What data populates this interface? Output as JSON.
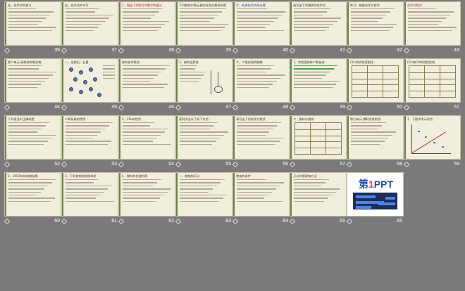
{
  "view": "slide-sorter",
  "slides": [
    {
      "number": "36",
      "title": "五、化学式的意义",
      "style": "text"
    },
    {
      "number": "37",
      "title": "五、化学式的书写",
      "style": "text"
    },
    {
      "number": "38",
      "title": "1、指出下列符号中数字的意义",
      "style": "text-red"
    },
    {
      "number": "39",
      "title": "下列物质中氮元素的化合价最高的是",
      "style": "text"
    },
    {
      "number": "40",
      "title": "六、有关化学式的计算",
      "style": "text-blue"
    },
    {
      "number": "41",
      "title": "请写出下列物质的化学式",
      "style": "text"
    },
    {
      "number": "42",
      "title": "练习：根据化学方程式",
      "style": "text"
    },
    {
      "number": "43",
      "title": "化学方程式",
      "style": "text-red"
    },
    {
      "number": "44",
      "title": "第二单元 碳和碳的氧化物",
      "style": "text"
    },
    {
      "number": "45",
      "title": "一、金刚石、石墨",
      "style": "molecule"
    },
    {
      "number": "46",
      "title": "碳的化学性质",
      "style": "text"
    },
    {
      "number": "47",
      "title": "2、碳的还原性",
      "style": "apparatus"
    },
    {
      "number": "48",
      "title": "二、二氧化碳的制取",
      "style": "text"
    },
    {
      "number": "49",
      "title": "1、实验室制取二氧化碳",
      "style": "highlight"
    },
    {
      "number": "50",
      "title": "CO₂的实验室制法",
      "style": "table"
    },
    {
      "number": "51",
      "title": "CO₂和CO的性质比较",
      "style": "table"
    },
    {
      "number": "52",
      "title": "下列说法中正确的是",
      "style": "text"
    },
    {
      "number": "53",
      "title": "二氧化碳的性质",
      "style": "text"
    },
    {
      "number": "54",
      "title": "2、CO₂的性质",
      "style": "text"
    },
    {
      "number": "55",
      "title": "某同学设计了如下实验",
      "style": "text"
    },
    {
      "number": "56",
      "title": "请写出下列化学方程式",
      "style": "text"
    },
    {
      "number": "57",
      "title": "二、燃料与燃烧",
      "style": "table"
    },
    {
      "number": "58",
      "title": "第七单元 燃料及其利用",
      "style": "text"
    },
    {
      "number": "59",
      "title": "7、下图中所示实验",
      "style": "chart"
    },
    {
      "number": "60",
      "title": "2、1992年的调查结果",
      "style": "text"
    },
    {
      "number": "61",
      "title": "3、下列各物质按照单质",
      "style": "text"
    },
    {
      "number": "62",
      "title": "4、燃料的合理利用",
      "style": "text"
    },
    {
      "number": "63",
      "title": "一、燃烧和灭火",
      "style": "text"
    },
    {
      "number": "64",
      "title": "燃烧的条件",
      "style": "text"
    },
    {
      "number": "65",
      "title": "灭火的原理和方法",
      "style": "text"
    },
    {
      "number": "66",
      "title": "第1PPT",
      "style": "ppt"
    }
  ],
  "ppt_logo": {
    "prefix": "第",
    "digit": "1",
    "suffix": "PPT"
  }
}
